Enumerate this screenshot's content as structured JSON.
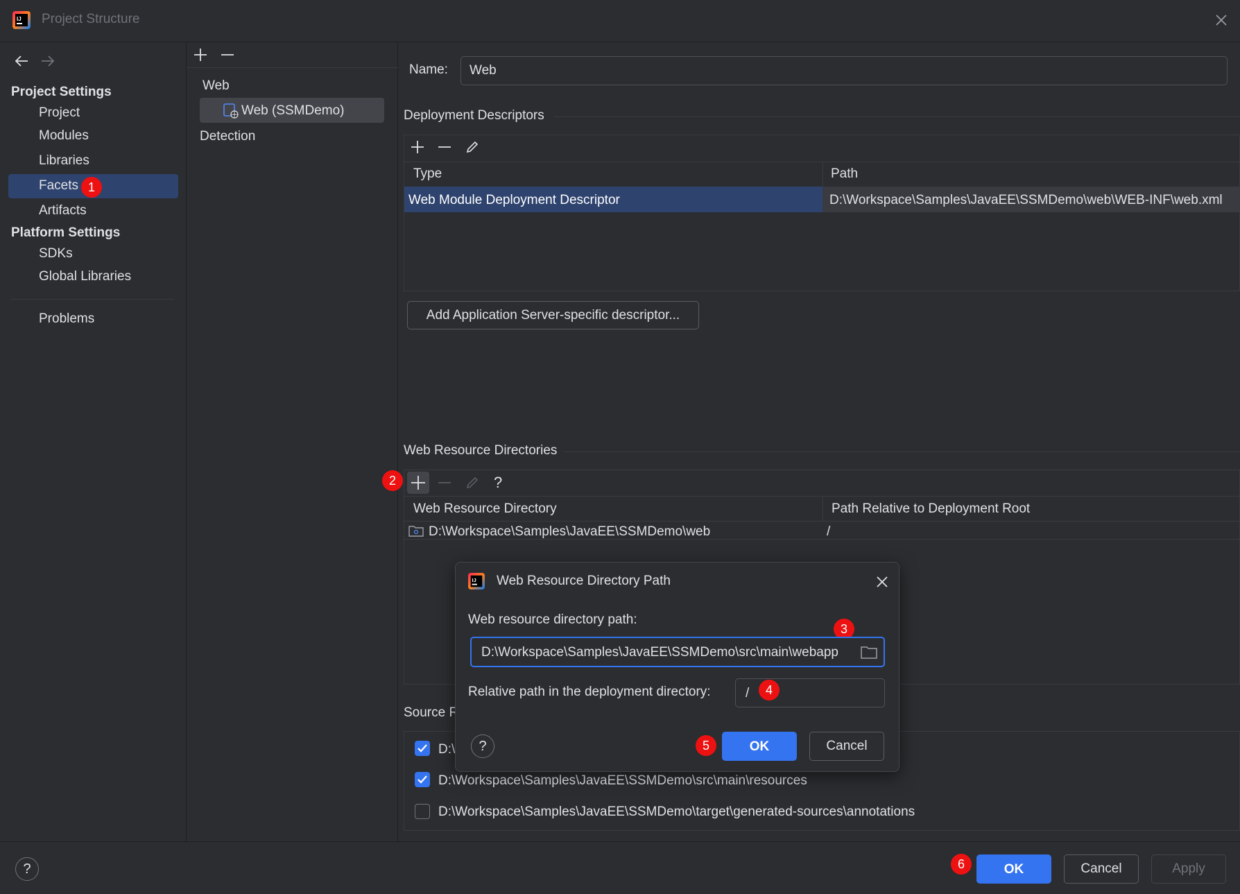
{
  "window": {
    "title": "Project Structure"
  },
  "sidebar": {
    "project_settings_header": "Project Settings",
    "project_items": [
      "Project",
      "Modules",
      "Libraries",
      "Facets",
      "Artifacts"
    ],
    "selected_item": "Facets",
    "platform_settings_header": "Platform Settings",
    "platform_items": [
      "SDKs",
      "Global Libraries"
    ],
    "problems": "Problems"
  },
  "facet_tree": {
    "group": "Web",
    "item": "Web (SSMDemo)",
    "detection": "Detection"
  },
  "name_field": {
    "label": "Name:",
    "value": "Web"
  },
  "deployment_descriptors": {
    "header": "Deployment Descriptors",
    "columns": [
      "Type",
      "Path"
    ],
    "rows": [
      {
        "type": "Web Module Deployment Descriptor",
        "path": "D:\\Workspace\\Samples\\JavaEE\\SSMDemo\\web\\WEB-INF\\web.xml"
      }
    ],
    "add_server_descriptor_button": "Add Application Server-specific descriptor..."
  },
  "web_resource_directories": {
    "header": "Web Resource Directories",
    "columns": [
      "Web Resource Directory",
      "Path Relative to Deployment Root"
    ],
    "rows": [
      {
        "directory": "D:\\Workspace\\Samples\\JavaEE\\SSMDemo\\web",
        "relative": "/"
      }
    ]
  },
  "source_roots": {
    "header_visible": "Source R",
    "items": [
      {
        "path": "D:\\",
        "checked": true
      },
      {
        "path": "D:\\Workspace\\Samples\\JavaEE\\SSMDemo\\src\\main\\resources",
        "checked": true
      },
      {
        "path": "D:\\Workspace\\Samples\\JavaEE\\SSMDemo\\target\\generated-sources\\annotations",
        "checked": false
      }
    ]
  },
  "dialog": {
    "title": "Web Resource Directory Path",
    "path_label": "Web resource directory path:",
    "path_value": "D:\\Workspace\\Samples\\JavaEE\\SSMDemo\\src\\main\\webapp",
    "relative_label": "Relative path in the deployment directory:",
    "relative_value": "/",
    "ok": "OK",
    "cancel": "Cancel",
    "help": "?"
  },
  "footer": {
    "ok": "OK",
    "cancel": "Cancel",
    "apply": "Apply",
    "help": "?"
  },
  "toolbar": {
    "help_glyph": "?"
  },
  "annotations": [
    "1",
    "2",
    "3",
    "4",
    "5",
    "6"
  ],
  "colors": {
    "background": "#2b2d30",
    "selection": "#2e436e",
    "primary_button": "#3574f0",
    "badge": "#ee1111"
  }
}
